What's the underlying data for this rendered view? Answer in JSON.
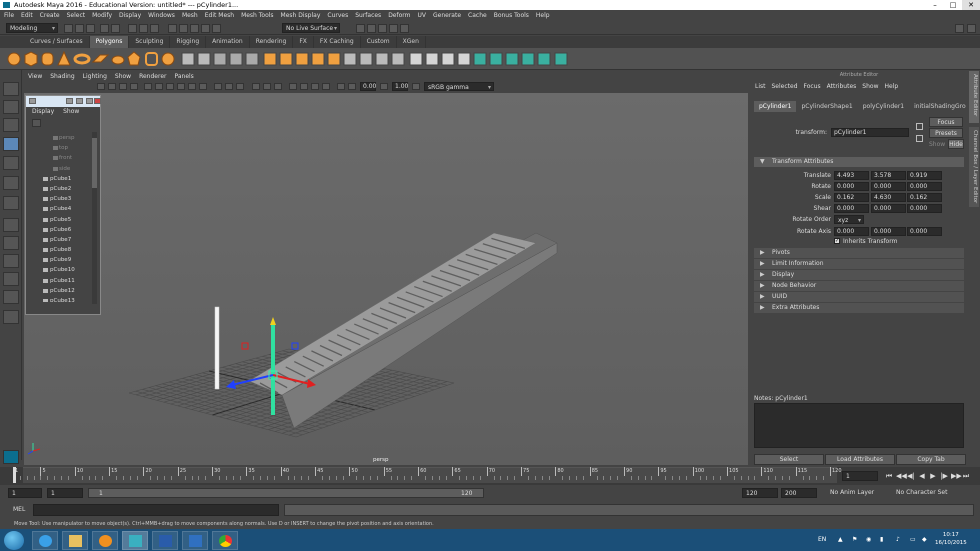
{
  "window": {
    "title": "Autodesk Maya 2016 - Educational Version: untitled*   ---   pCylinder1...",
    "min": "–",
    "max": "□",
    "close": "✕"
  },
  "menubar": [
    "File",
    "Edit",
    "Create",
    "Select",
    "Modify",
    "Display",
    "Windows",
    "Mesh",
    "Edit Mesh",
    "Mesh Tools",
    "Mesh Display",
    "Curves",
    "Surfaces",
    "Deform",
    "UV",
    "Generate",
    "Cache",
    "Bonus Tools",
    "Help"
  ],
  "statusline": {
    "mode": "Modeling",
    "live_surface": "No Live Surface"
  },
  "shelf_tabs": [
    "Curves / Surfaces",
    "Polygons",
    "Sculpting",
    "Rigging",
    "Animation",
    "Rendering",
    "FX",
    "FX Caching",
    "Custom",
    "XGen"
  ],
  "shelf_active": "Polygons",
  "panel_menu": [
    "View",
    "Shading",
    "Lighting",
    "Show",
    "Renderer",
    "Panels"
  ],
  "panel_toolbar": {
    "exposure": "0.00",
    "gamma": "1.00",
    "color_space": "sRGB gamma"
  },
  "viewport": {
    "camera_label": "persp"
  },
  "outliner": {
    "menu": [
      "Display",
      "Show"
    ],
    "cameras": [
      "persp",
      "top",
      "front",
      "side"
    ],
    "items": [
      "pCube1",
      "pCube2",
      "pCube3",
      "pCube4",
      "pCube5",
      "pCube6",
      "pCube7",
      "pCube8",
      "pCube9",
      "pCube10",
      "pCube11",
      "pCube12",
      "pCube13"
    ]
  },
  "attribute_editor": {
    "title": "Attribute Editor",
    "menu": [
      "List",
      "Selected",
      "Focus",
      "Attributes",
      "Show",
      "Help"
    ],
    "tabs": [
      "pCylinder1",
      "pCylinderShape1",
      "polyCylinder1",
      "initialShadingGro"
    ],
    "transform_label": "transform:",
    "transform_value": "pCylinder1",
    "focus": "Focus",
    "presets": "Presets",
    "show": "Show",
    "hide": "Hide",
    "section_transform": "Transform Attributes",
    "translate_label": "Translate",
    "translate": [
      "4.493",
      "3.578",
      "0.919"
    ],
    "rotate_label": "Rotate",
    "rotate": [
      "0.000",
      "0.000",
      "0.000"
    ],
    "scale_label": "Scale",
    "scale": [
      "0.162",
      "4.630",
      "0.162"
    ],
    "shear_label": "Shear",
    "shear": [
      "0.000",
      "0.000",
      "0.000"
    ],
    "rotate_order_label": "Rotate Order",
    "rotate_order": "xyz",
    "rotate_axis_label": "Rotate Axis",
    "rotate_axis": [
      "0.000",
      "0.000",
      "0.000"
    ],
    "inherits": "Inherits Transform",
    "sections": [
      "Pivots",
      "Limit Information",
      "Display",
      "Node Behavior",
      "UUID",
      "Extra Attributes"
    ],
    "notes": "Notes:  pCylinder1",
    "btn_select": "Select",
    "btn_load": "Load Attributes",
    "btn_copy": "Copy Tab"
  },
  "side_tabs": [
    "Attribute Editor",
    "Channel Box / Layer Editor"
  ],
  "time_slider": {
    "ticks": [
      "1",
      "5",
      "10",
      "15",
      "20",
      "25",
      "30",
      "35",
      "40",
      "45",
      "50",
      "55",
      "60",
      "65",
      "70",
      "75",
      "80",
      "85",
      "90",
      "95",
      "100",
      "105",
      "110",
      "115",
      "120"
    ],
    "current_frame": "1",
    "controls": [
      "⏮",
      "◀◀",
      "◀|",
      "◀",
      "▶",
      "|▶",
      "▶▶",
      "⏭"
    ]
  },
  "range_slider": {
    "start": "1",
    "playback_start": "1",
    "range_start_label": "1",
    "range_end_label": "120",
    "end": "120",
    "anim_end": "200",
    "anim_layer": "No Anim Layer",
    "char_set": "No Character Set"
  },
  "command_line": {
    "lang": "MEL"
  },
  "help_line": "Move Tool: Use manipulator to move object(s). Ctrl+MMB+drag to move components along normals. Use D or INSERT to change the pivot position and axis orientation.",
  "taskbar": {
    "time": "10:17",
    "date": "16/10/2015",
    "lang": "EN"
  },
  "colors": {
    "x_axis": "#e02020",
    "y_axis": "#30e0a0",
    "z_axis": "#2040ff",
    "stair": "#9b9b9b"
  }
}
